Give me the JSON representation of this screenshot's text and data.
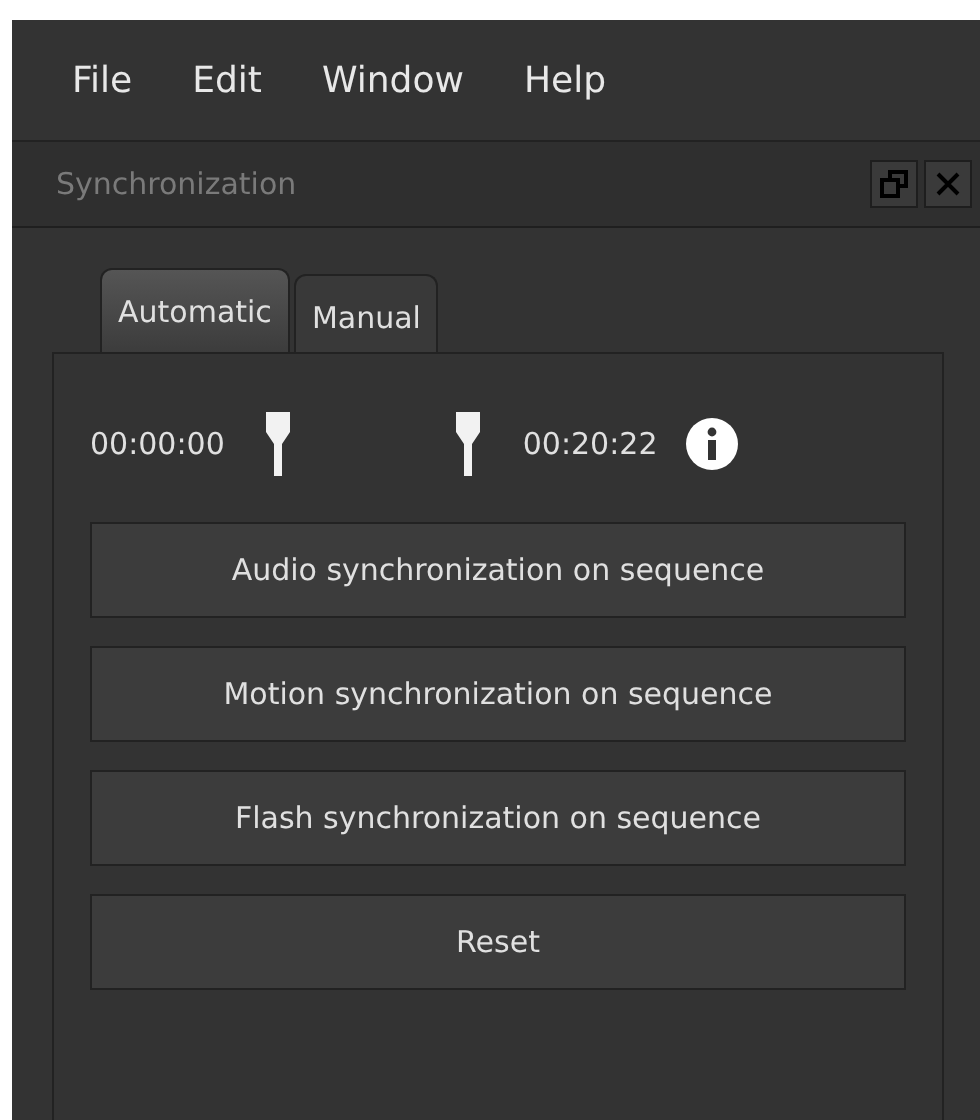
{
  "menu": [
    "File",
    "Edit",
    "Window",
    "Help"
  ],
  "panel": {
    "title": "Synchronization"
  },
  "tabs": [
    {
      "label": "Automatic",
      "selected": true
    },
    {
      "label": "Manual",
      "selected": false
    }
  ],
  "range": {
    "start": "00:00:00",
    "end": "00:20:22",
    "handles": [
      {
        "level": 0.12
      },
      {
        "level": 0.88
      }
    ]
  },
  "buttons": [
    "Audio synchronization on sequence",
    "Motion synchronization on sequence",
    "Flash synchronization on sequence",
    "Reset"
  ]
}
